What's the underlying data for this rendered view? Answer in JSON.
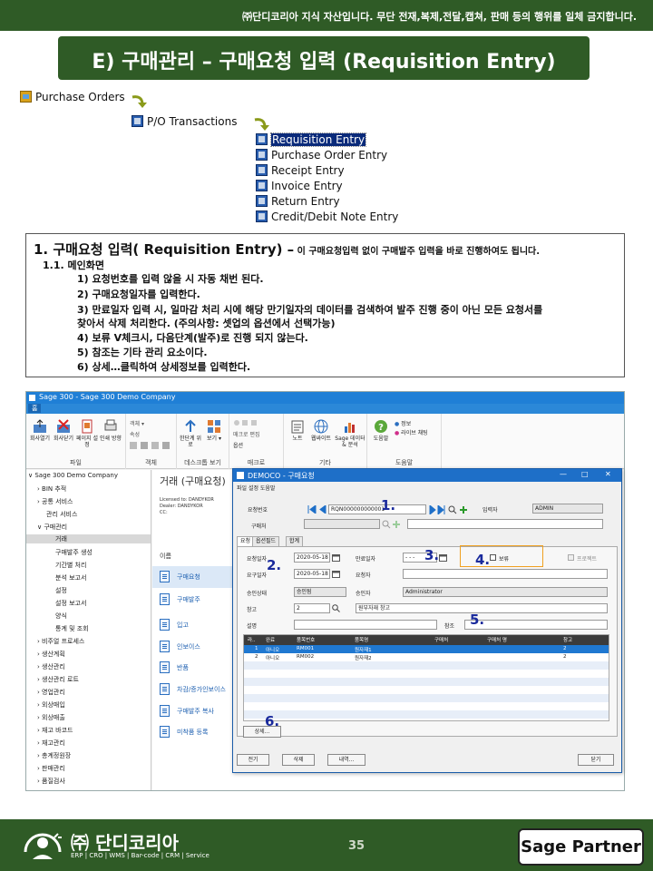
{
  "banner": {
    "notice": "㈜단디코리아 지식 자산입니다. 무단 전재,복제,전달,캡쳐, 판매 등의 행위를 일체 금지합니다.",
    "title": "E) 구매관리 – 구매요청 입력 (Requisition Entry)"
  },
  "menu_tree": {
    "root": "Purchase Orders",
    "group": "P/O Transactions",
    "items": [
      {
        "label": "Requisition Entry",
        "selected": true
      },
      {
        "label": "Purchase Order Entry",
        "selected": false
      },
      {
        "label": "Receipt Entry",
        "selected": false
      },
      {
        "label": "Invoice Entry",
        "selected": false
      },
      {
        "label": "Return Entry",
        "selected": false
      },
      {
        "label": "Credit/Debit Note Entry",
        "selected": false
      }
    ]
  },
  "description": {
    "heading": "1. 구매요청 입력( Requisition Entry) –",
    "heading_note": " 이 구매요청입력 없이 구매발주 입력을 바로 진행하여도 됩니다.",
    "subheading": "1.1. 메인화면",
    "lines": [
      "1) 요청번호를 입력 않을 시 자동 채번 된다.",
      "2) 구매요청일자를 입력한다.",
      "3) 만료일자 입력 시, 일마감 처리 시에 해당 만기일자의 데이터를 검색하여 발주 진행 중이 아닌 모든 요청서를",
      "찾아서 삭제 처리한다. (주의사항: 셋업의 옵션에서 선택가능)",
      "4) 보류 V체크시, 다음단계(발주)로 진행 되지 않는다.",
      "5) 참조는 기타 관리 요소이다.",
      "6) 상세…클릭하여 상세정보를 입력한다."
    ]
  },
  "app": {
    "window_title": "Sage 300 - Sage 300 Demo Company",
    "tab": "홈",
    "ribbon": {
      "file_group": "파일",
      "file_buttons": [
        "회사열기",
        "회사닫기",
        "페이지 설정",
        "인쇄 방향"
      ],
      "object_group": "객체",
      "object_items": [
        "객체 ▾",
        "속성"
      ],
      "desktop_group": "데스크톱 보기",
      "desktop_buttons": [
        "한단계 위로",
        "보기 ▾"
      ],
      "macro_group": "매크로",
      "macro_items": [
        "매크로 편집",
        "옵션"
      ],
      "etc_group": "기타",
      "etc_buttons": [
        "노트",
        "웹싸이트",
        "Sage 데이터 & 분석"
      ],
      "help_group": "도움말",
      "help_buttons": [
        "도움말"
      ],
      "help_items": [
        "정보",
        "라이브 채팅"
      ]
    },
    "side_tree": [
      {
        "label": "∨ Sage 300 Demo Company",
        "indent": 0
      },
      {
        "label": "› BIN 추적",
        "indent": 1
      },
      {
        "label": "› 공통 서비스",
        "indent": 1
      },
      {
        "label": "관리 서비스",
        "indent": 1
      },
      {
        "label": "∨ 구매관리",
        "indent": 1
      },
      {
        "label": "거래",
        "indent": 2,
        "selected": true
      },
      {
        "label": "구매발주 생성",
        "indent": 2
      },
      {
        "label": "기간별 처리",
        "indent": 2
      },
      {
        "label": "분석 보고서",
        "indent": 2
      },
      {
        "label": "설정",
        "indent": 2
      },
      {
        "label": "설정 보고서",
        "indent": 2
      },
      {
        "label": "양식",
        "indent": 2
      },
      {
        "label": "통계 및 조회",
        "indent": 2
      },
      {
        "label": "› 비주얼 프로세스",
        "indent": 1
      },
      {
        "label": "› 생산계획",
        "indent": 1
      },
      {
        "label": "› 생산관리",
        "indent": 1
      },
      {
        "label": "› 생산관리 로트",
        "indent": 1
      },
      {
        "label": "› 영업관리",
        "indent": 1
      },
      {
        "label": "› 외상매입",
        "indent": 1
      },
      {
        "label": "› 외상매출",
        "indent": 1
      },
      {
        "label": "› 재고 바코드",
        "indent": 1
      },
      {
        "label": "› 재고관리",
        "indent": 1
      },
      {
        "label": "› 총계정원장",
        "indent": 1
      },
      {
        "label": "› 판매관리",
        "indent": 1
      },
      {
        "label": "› 품질검사",
        "indent": 1
      }
    ],
    "content": {
      "heading": "거래 (구매요청)",
      "meta": [
        "Licensed to:   DANDYKOR",
        "Dealer:          DANDYKOR",
        "CC:"
      ],
      "list_heading": "이름",
      "commands": [
        {
          "label": "구매요청",
          "selected": true
        },
        {
          "label": "구매발주",
          "selected": false
        },
        {
          "label": "입고",
          "selected": false
        },
        {
          "label": "인보이스",
          "selected": false
        },
        {
          "label": "반품",
          "selected": false
        },
        {
          "label": "차감/증가인보이스",
          "selected": false
        },
        {
          "label": "구매발주 복사",
          "selected": false
        },
        {
          "label": "미착품 등록",
          "selected": false
        }
      ]
    }
  },
  "dialog": {
    "title": "DEMOCO - 구매요청",
    "controls": [
      "—",
      "□",
      "✕"
    ],
    "menu": "파일  설정  도움말",
    "req_no_label": "요청번호",
    "req_no_value": "RQN000000000001",
    "entered_by_label": "입력자",
    "entered_by_value": "ADMIN",
    "vendor_label": "구매처",
    "tabs": [
      "요청",
      "옵션필드",
      "합계"
    ],
    "date_label": "요청일자",
    "date_value": "2020-05-18",
    "expire_label": "만료일자",
    "expire_value": "- - -",
    "hold_label": "보류",
    "job_label": "프로젝트",
    "required_label": "요구일자",
    "required_value": "2020-05-18",
    "requester_label": "요청자",
    "approval_status_label": "승인상태",
    "approval_status_value": "승인됨",
    "approver_label": "승인자",
    "approver_value": "Administrator",
    "warehouse_label": "창고",
    "warehouse_value": "2",
    "warehouse_desc": "원부자재 창고",
    "desc_label": "설명",
    "ref_label": "참조",
    "grid": {
      "columns": [
        "라..",
        "완료",
        "품목번호",
        "품목명",
        "구매처",
        "구매처 명",
        "창고"
      ],
      "rows": [
        [
          "1",
          "아니오",
          "RM001",
          "원자재1",
          "",
          "",
          "2"
        ],
        [
          "2",
          "아니오",
          "RM002",
          "원자재2",
          "",
          "",
          "2"
        ]
      ]
    },
    "detail_button": "상세...",
    "buttons": [
      "전기",
      "삭제",
      "내역...",
      "닫기"
    ],
    "callouts": [
      "1.",
      "2.",
      "3.",
      "4.",
      "5.",
      "6."
    ]
  },
  "footer": {
    "brand": "㈜ 단디코리아",
    "tagline": "ERP | CRO | WMS | Bar-code | CRM | Service",
    "page": "35",
    "partner": "Sage Partner"
  },
  "colors": {
    "green": "#2f5b26",
    "blue": "#1e6fc8",
    "callout": "#1a2a9c"
  }
}
